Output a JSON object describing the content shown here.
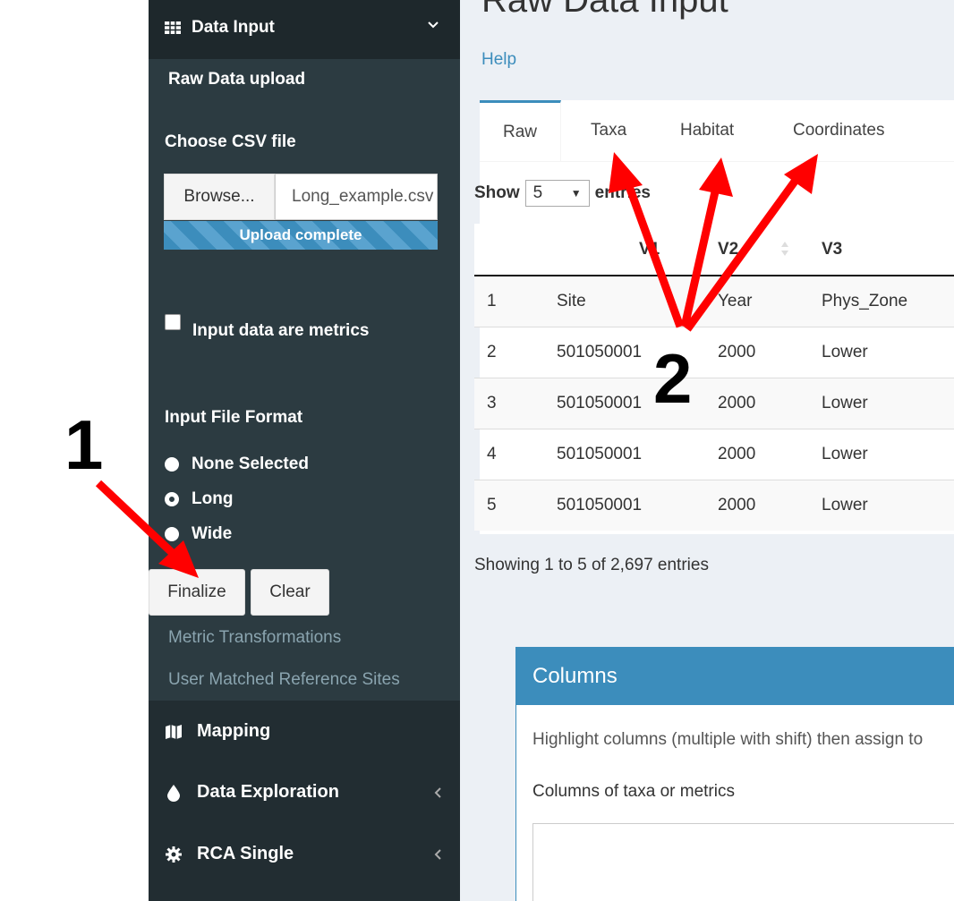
{
  "sidebar": {
    "data_input": "Data Input",
    "raw_upload": "Raw Data upload",
    "choose_csv": "Choose CSV file",
    "browse": "Browse...",
    "file_name": "Long_example.csv",
    "upload_status": "Upload complete",
    "metrics_label": "Input data are metrics",
    "format_label": "Input File Format",
    "format_options": [
      "None Selected",
      "Long",
      "Wide"
    ],
    "format_selected": "Long",
    "finalize": "Finalize",
    "clear": "Clear",
    "metric_transformations": "Metric Transformations",
    "user_matched": "User Matched Reference Sites",
    "mapping": "Mapping",
    "data_exploration": "Data Exploration",
    "rca_single": "RCA Single"
  },
  "main": {
    "title": "Raw Data Input",
    "help": "Help",
    "tabs": [
      "Raw",
      "Taxa",
      "Habitat",
      "Coordinates"
    ],
    "show_prefix": "Show",
    "show_value": "5",
    "show_suffix": "entries",
    "table": {
      "headers": [
        "",
        "V1",
        "V2",
        "V3"
      ],
      "rows": [
        [
          "1",
          "Site",
          "Year",
          "Phys_Zone"
        ],
        [
          "2",
          "501050001",
          "2000",
          "Lower"
        ],
        [
          "3",
          "501050001",
          "2000",
          "Lower"
        ],
        [
          "4",
          "501050001",
          "2000",
          "Lower"
        ],
        [
          "5",
          "501050001",
          "2000",
          "Lower"
        ]
      ]
    },
    "info": "Showing 1 to 5 of 2,697 entries",
    "columns": {
      "title": "Columns",
      "hint": "Highlight columns (multiple with shift) then assign to",
      "label": "Columns of taxa or metrics"
    }
  },
  "annotations": {
    "marker1": "1",
    "marker2": "2",
    "arrow_color": "#ff0000"
  },
  "colors": {
    "sidebar_bg": "#222d32",
    "accent": "#3c8dbc"
  }
}
